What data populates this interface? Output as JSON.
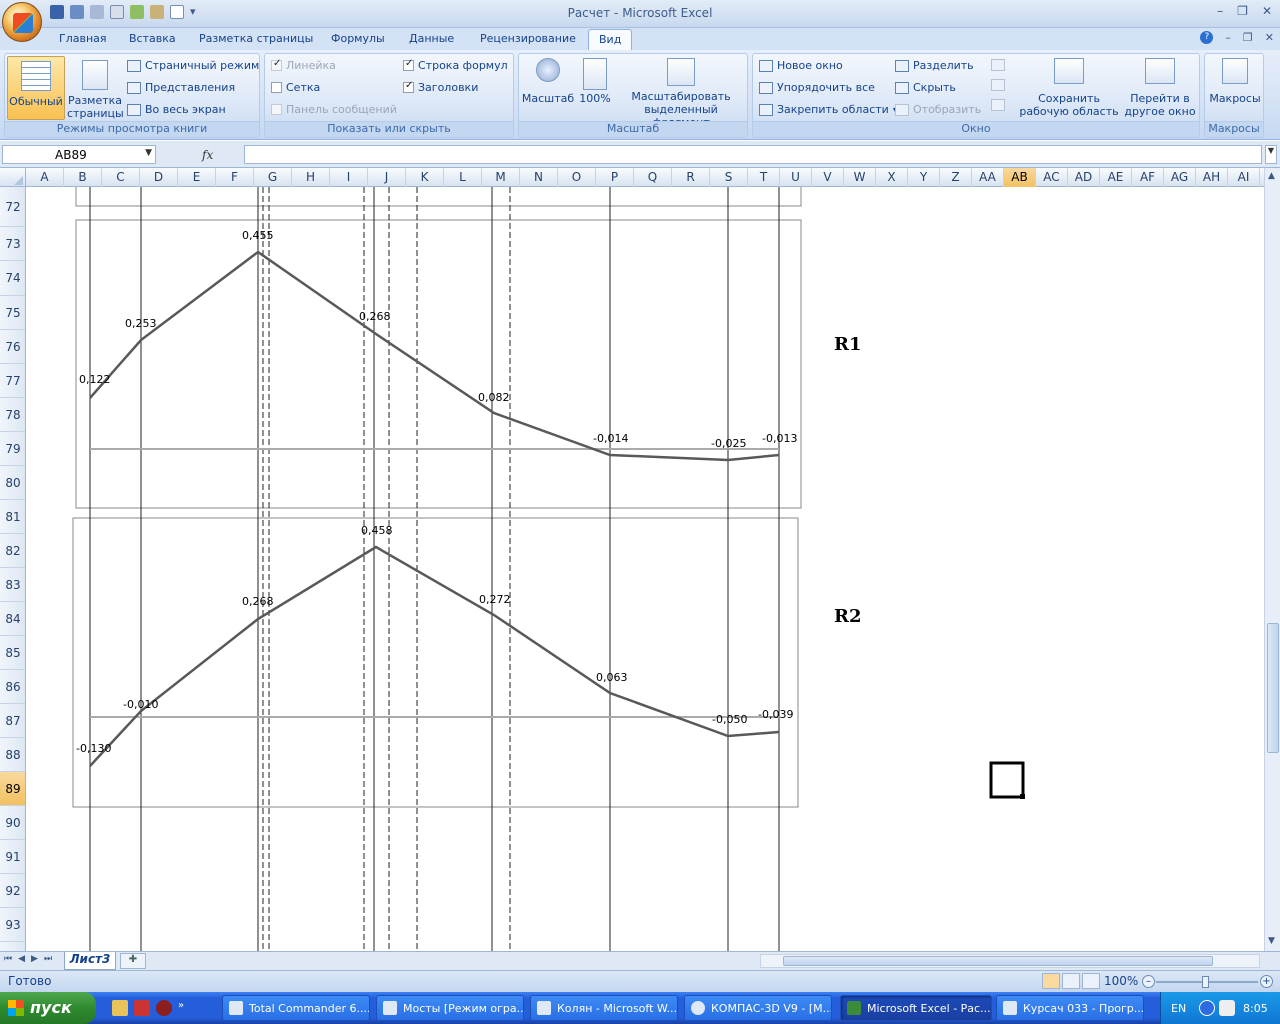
{
  "window": {
    "title": "Расчет - Microsoft Excel"
  },
  "tabs": [
    "Главная",
    "Вставка",
    "Разметка страницы",
    "Формулы",
    "Данные",
    "Рецензирование",
    "Вид"
  ],
  "active_tab": "Вид",
  "ribbon": {
    "views": {
      "title": "Режимы просмотра книги",
      "normal": "Обычный",
      "page_layout": "Разметка страницы",
      "page_break": "Страничный режим",
      "custom_views": "Представления",
      "full_screen": "Во весь экран"
    },
    "show": {
      "title": "Показать или скрыть",
      "ruler": "Линейка",
      "gridlines": "Сетка",
      "message_bar": "Панель сообщений",
      "formula_bar": "Строка формул",
      "headings": "Заголовки"
    },
    "zoom": {
      "title": "Масштаб",
      "zoom": "Масштаб",
      "hundred": "100%",
      "zoom_selection": "Масштабировать выделенный фрагмент"
    },
    "window": {
      "title": "Окно",
      "new_window": "Новое окно",
      "arrange_all": "Упорядочить все",
      "freeze": "Закрепить области",
      "split": "Разделить",
      "hide": "Скрыть",
      "unhide": "Отобразить",
      "save_workspace": "Сохранить рабочую область",
      "switch_windows": "Перейти в другое окно"
    },
    "macros": {
      "title": "Макросы",
      "macros": "Макросы"
    }
  },
  "formula_bar": {
    "name_box": "AB89",
    "fx": "fx",
    "value": ""
  },
  "columns": [
    "A",
    "B",
    "C",
    "D",
    "E",
    "F",
    "G",
    "H",
    "I",
    "J",
    "K",
    "L",
    "M",
    "N",
    "O",
    "P",
    "Q",
    "R",
    "S",
    "T",
    "U",
    "V",
    "W",
    "X",
    "Y",
    "Z",
    "AA",
    "AB",
    "AC",
    "AD",
    "AE",
    "AF",
    "AG",
    "AH",
    "AI",
    "A"
  ],
  "selected_column": "AB",
  "rows": [
    "72",
    "73",
    "74",
    "75",
    "76",
    "77",
    "78",
    "79",
    "80",
    "81",
    "82",
    "83",
    "84",
    "85",
    "86",
    "87",
    "88",
    "89",
    "90",
    "91",
    "92",
    "93"
  ],
  "selected_row": "89",
  "charts": {
    "r1": {
      "label": "R1",
      "values": [
        "0,122",
        "0,253",
        "0,455",
        "0,268",
        "0,082",
        "-0,014",
        "-0,025",
        "-0,013"
      ]
    },
    "r2": {
      "label": "R2",
      "values": [
        "-0,130",
        "-0,010",
        "0,268",
        "0,458",
        "0,272",
        "0,063",
        "-0,050",
        "-0,039"
      ]
    }
  },
  "sheet_tabs": [
    "Лист3"
  ],
  "status": {
    "ready": "Готово",
    "zoom": "100%"
  },
  "taskbar": {
    "start": "пуск",
    "tasks": [
      "Total Commander 6....",
      "Мосты [Режим огра...",
      "Колян - Microsoft W...",
      "КОМПАС-3D V9 - [М...",
      "Microsoft Excel - Рас...",
      "Курсач 033 - Прогр..."
    ],
    "active_task": "Microsoft Excel - Рас...",
    "lang": "EN",
    "clock": "8:05"
  },
  "colors": {
    "ribbon_bg": "#d1e0f4",
    "selected_header": "#f1c15f",
    "chart_line": "#595959",
    "taskbar": "#245edb",
    "start_green": "#2f8a2f"
  }
}
